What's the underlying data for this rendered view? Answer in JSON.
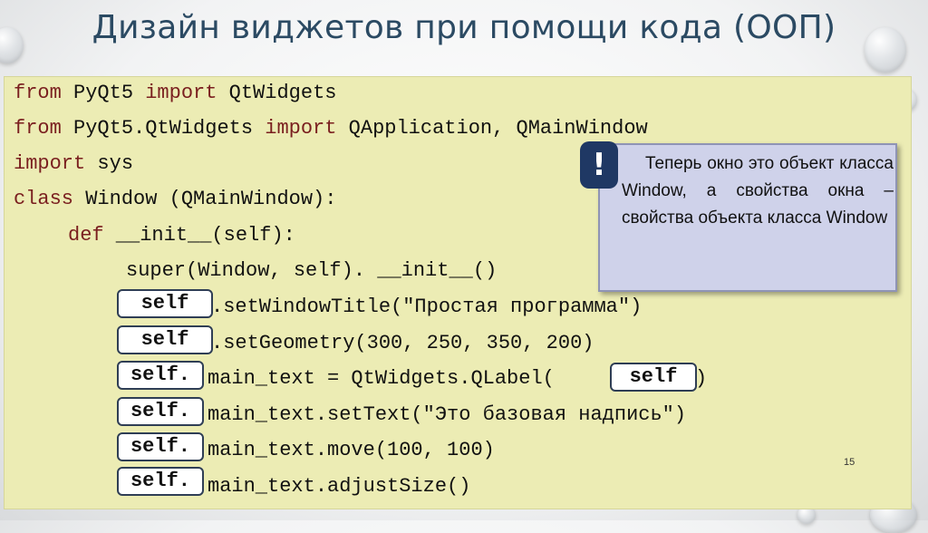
{
  "slide": {
    "title": "Дизайн виджетов при помощи кода (ООП)",
    "page_number": "15"
  },
  "code": {
    "l1_kw1": "from",
    "l1_a": " PyQt5 ",
    "l1_kw2": "import",
    "l1_b": " QtWidgets",
    "l2_kw1": "from",
    "l2_a": " PyQt5.QtWidgets ",
    "l2_kw2": "import",
    "l2_b": " QApplication, QMainWindow",
    "l3_kw1": "import",
    "l3_a": " sys",
    "l4_kw1": "class",
    "l4_a": " Window (QMainWindow):",
    "l5_kw1": "def",
    "l5_a": " __init__(self):",
    "l6_a": "super(Window, self). __init__()",
    "l7_a": ".setWindowTitle(\"Простая программа\")",
    "l8_a": ".setGeometry(300, 250, 350, 200)",
    "l9_a": "main_text = QtWidgets.QLabel(",
    "l9_b": ")",
    "l10_a": "main_text.setText(\"Это базовая надпись\")",
    "l11_a": "main_text.move(100, 100)",
    "l12_a": "main_text.adjustSize()"
  },
  "blanks": {
    "b1": "self",
    "b2": "self",
    "b3": "self.",
    "b4": "self",
    "b5": "self.",
    "b6": "self.",
    "b7": "self."
  },
  "note": {
    "badge": "!",
    "text": "Теперь окно это объект класса Window, а свойства окна – свойства объекта класса Window"
  }
}
